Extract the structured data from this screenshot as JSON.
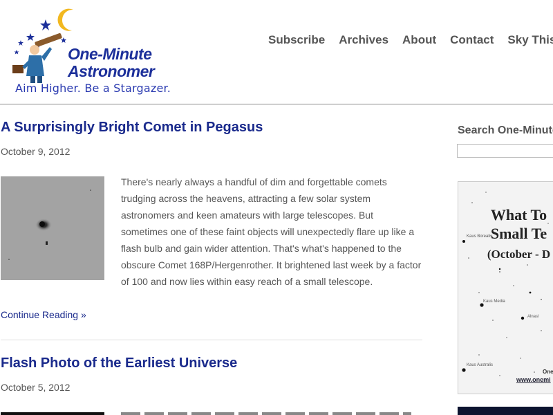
{
  "site": {
    "logo_title_line1": "One-Minute",
    "logo_title_line2": "Astronomer",
    "tagline": "Aim Higher. Be a Stargazer."
  },
  "nav": {
    "items": [
      {
        "label": "Subscribe"
      },
      {
        "label": "Archives"
      },
      {
        "label": "About"
      },
      {
        "label": "Contact"
      },
      {
        "label": "Sky This"
      }
    ]
  },
  "posts": [
    {
      "title": "A Surprisingly Bright Comet in Pegasus",
      "date": "October 9, 2012",
      "excerpt": "There's nearly always a handful of dim and forgettable comets trudging across the heavens, attracting a few solar system astronomers and keen amateurs with large telescopes.  But sometimes one of these faint objects will unexpectedly flare up like a flash bulb and gain wider attention.  That's what's happened to the obscure Comet 168P/Hergenrother.  It brightened last week by a factor of 100 and now lies within easy reach of a small  telescope.",
      "more": "Continue Reading »"
    },
    {
      "title": "Flash Photo of the Earliest Universe",
      "date": "October 5, 2012"
    }
  ],
  "sidebar": {
    "search_heading": "Search One-Minute",
    "ad": {
      "title_line1": "What To",
      "title_line2": "Small Te",
      "subtitle": "(October - D",
      "labels": {
        "kaus_borealis": "Kaus Borealis",
        "kaus_media": "Kaus Media",
        "alnasl": "Alnasl",
        "kaus_australis": "Kaus Australis"
      },
      "footer_line1": "One",
      "footer_url": "www.onemi"
    }
  },
  "colors": {
    "link": "#1a2a8c",
    "nav_text": "#555555",
    "logo_blue": "#1c2f9a",
    "moon_yellow": "#f2b820"
  }
}
